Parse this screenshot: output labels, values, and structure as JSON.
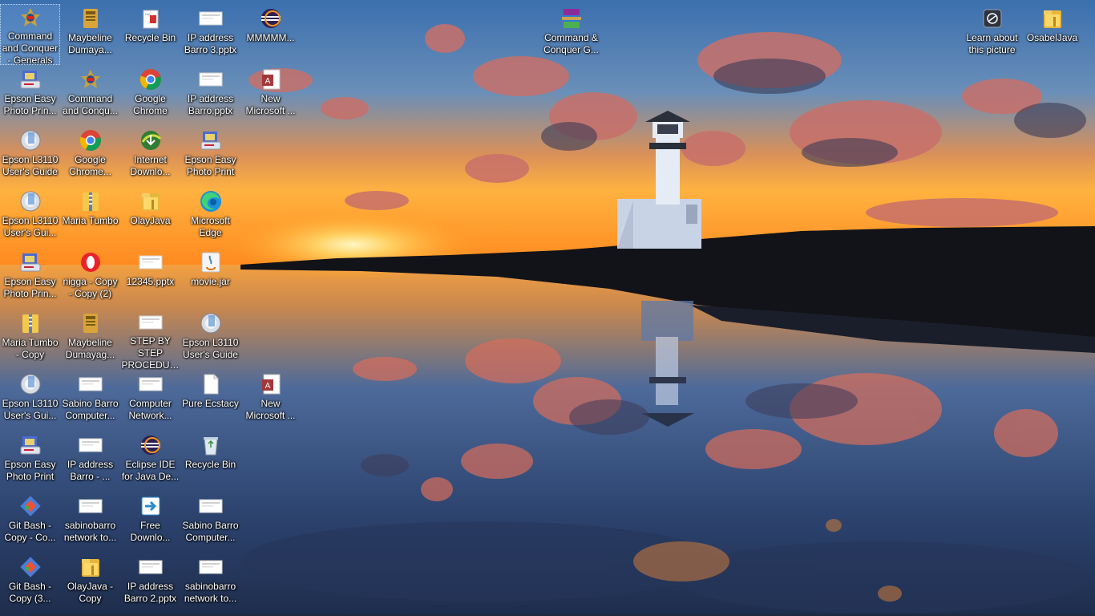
{
  "desktop": {
    "columns": [
      [
        {
          "label": "Command and Conquer - Generals",
          "icon": "generals-game-icon",
          "selected": true
        },
        {
          "label": "Epson Easy Photo Prin...",
          "icon": "epson-photo-icon"
        },
        {
          "label": "Epson L3110 User's Guide",
          "icon": "epson-guide-icon"
        },
        {
          "label": "Epson L3110 User's Gui...",
          "icon": "epson-guide-icon"
        },
        {
          "label": "Epson Easy Photo Prin...",
          "icon": "epson-photo-icon"
        },
        {
          "label": "Maria Tumbo - Copy",
          "icon": "zip-folder-icon"
        },
        {
          "label": "Epson L3110 User's Gui...",
          "icon": "epson-guide-icon"
        },
        {
          "label": "Epson Easy Photo Print",
          "icon": "epson-photo-icon"
        },
        {
          "label": "Git Bash - Copy - Co...",
          "icon": "git-bash-icon"
        },
        {
          "label": "Git Bash - Copy (3...",
          "icon": "git-bash-icon"
        }
      ],
      [
        {
          "label": "Maybeline Dumaya...",
          "icon": "archive-book-icon"
        },
        {
          "label": "Command and Conqu...",
          "icon": "generals-game-icon"
        },
        {
          "label": "Google Chrome...",
          "icon": "chrome-icon"
        },
        {
          "label": "Maria Tumbo",
          "icon": "zip-folder-icon"
        },
        {
          "label": "nigga - Copy - Copy (2)",
          "icon": "opera-icon"
        },
        {
          "label": "Maybeline Dumayag...",
          "icon": "archive-book-icon"
        },
        {
          "label": "Sabino Barro Computer...",
          "icon": "pptx-file-icon"
        },
        {
          "label": "IP address Barro - ...",
          "icon": "pptx-file-icon"
        },
        {
          "label": "sabinobarro network to...",
          "icon": "pptx-file-icon"
        },
        {
          "label": "OlayJava - Copy",
          "icon": "folder-icon"
        }
      ],
      [
        {
          "label": "Recycle Bin",
          "icon": "recycle-bin-red-icon"
        },
        {
          "label": "Google Chrome",
          "icon": "chrome-icon"
        },
        {
          "label": "Internet Downlo...",
          "icon": "idm-icon"
        },
        {
          "label": "OlayJava",
          "icon": "folder-icon"
        },
        {
          "label": "12345.pptx",
          "icon": "pptx-file-icon"
        },
        {
          "label": "STEP BY STEP PROCEDUR...",
          "icon": "pptx-file-icon"
        },
        {
          "label": "Computer Network...",
          "icon": "pptx-file-icon"
        },
        {
          "label": "Eclipse IDE for Java De...",
          "icon": "eclipse-icon"
        },
        {
          "label": "Free Downlo...",
          "icon": "free-download-icon"
        },
        {
          "label": "IP address Barro 2.pptx",
          "icon": "pptx-file-icon"
        }
      ],
      [
        {
          "label": "IP address Barro 3.pptx",
          "icon": "pptx-file-icon"
        },
        {
          "label": "IP address Barro.pptx",
          "icon": "pptx-file-icon"
        },
        {
          "label": "Epson Easy Photo Print",
          "icon": "epson-photo-icon"
        },
        {
          "label": "Microsoft Edge",
          "icon": "edge-icon"
        },
        {
          "label": "movie.jar",
          "icon": "java-jar-icon"
        },
        {
          "label": "Epson L3110 User's Guide",
          "icon": "epson-guide-icon"
        },
        {
          "label": "Pure Ecstacy",
          "icon": "blank-file-icon"
        },
        {
          "label": "Recycle Bin",
          "icon": "recycle-bin-icon"
        },
        {
          "label": "Sabino Barro Computer...",
          "icon": "pptx-file-icon"
        },
        {
          "label": "sabinobarro network to...",
          "icon": "pptx-file-icon"
        }
      ]
    ],
    "extra_icons": {
      "mmmmm": {
        "label": "MMMMM...",
        "icon": "eclipse-icon"
      },
      "new_access_1": {
        "label": "New Microsoft ...",
        "icon": "access-icon"
      },
      "new_access_2": {
        "label": "New Microsoft ...",
        "icon": "access-icon"
      },
      "winrar": {
        "label": "Command & Conquer G...",
        "icon": "winrar-icon"
      },
      "learn_about": {
        "label": "Learn about this picture",
        "icon": "camera-icon"
      },
      "osabel": {
        "label": "OsabelJava",
        "icon": "folder-icon"
      }
    }
  },
  "colors": {
    "sky_top": "#3d6fa8",
    "sunset": "#ff9b2f",
    "cloud_pink": "#e4806a",
    "water": "#2b3f66",
    "label_text": "#ffffff"
  }
}
